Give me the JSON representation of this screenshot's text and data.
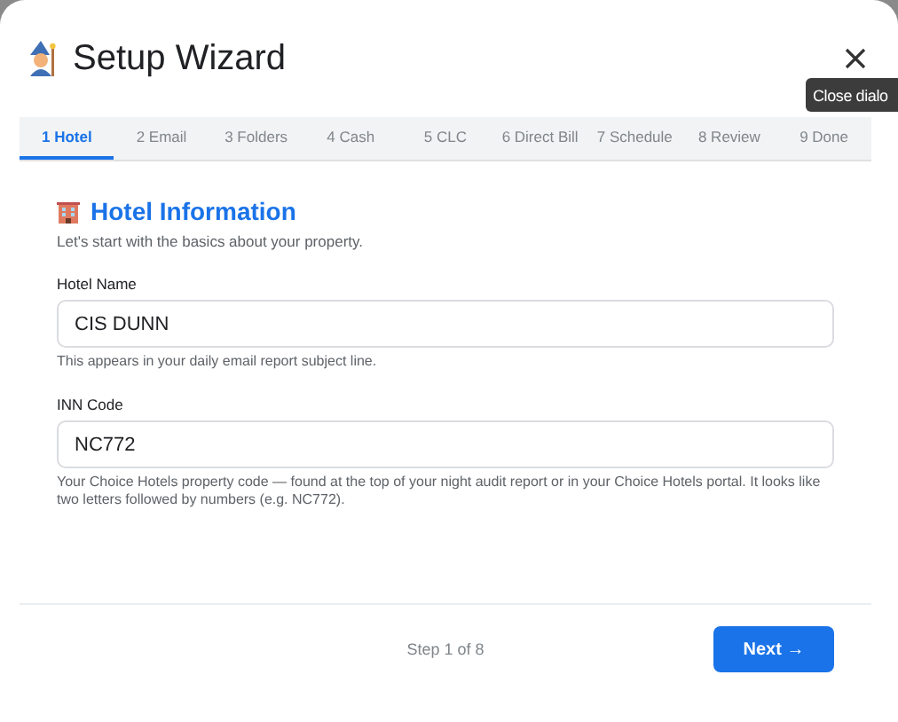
{
  "dialog": {
    "title": "Setup Wizard",
    "close_tooltip": "Close dialo"
  },
  "tabs": [
    {
      "label": "1 Hotel",
      "selected": true
    },
    {
      "label": "2 Email",
      "selected": false
    },
    {
      "label": "3 Folders",
      "selected": false
    },
    {
      "label": "4 Cash",
      "selected": false
    },
    {
      "label": "5 CLC",
      "selected": false
    },
    {
      "label": "6 Direct Bill",
      "selected": false
    },
    {
      "label": "7 Schedule",
      "selected": false
    },
    {
      "label": "8 Review",
      "selected": false
    },
    {
      "label": "9 Done",
      "selected": false
    }
  ],
  "section": {
    "heading": "Hotel Information",
    "subtitle": "Let's start with the basics about your property."
  },
  "fields": [
    {
      "label": "Hotel Name",
      "value": "CIS DUNN",
      "help": "This appears in your daily email report subject line."
    },
    {
      "label": "INN Code",
      "value": "NC772",
      "help": "Your Choice Hotels property code — found at the top of your night audit report or in your Choice Hotels portal. It looks like two letters followed by numbers (e.g. NC772)."
    }
  ],
  "footer": {
    "step": "Step 1 of 8",
    "next_button": "Next →"
  }
}
